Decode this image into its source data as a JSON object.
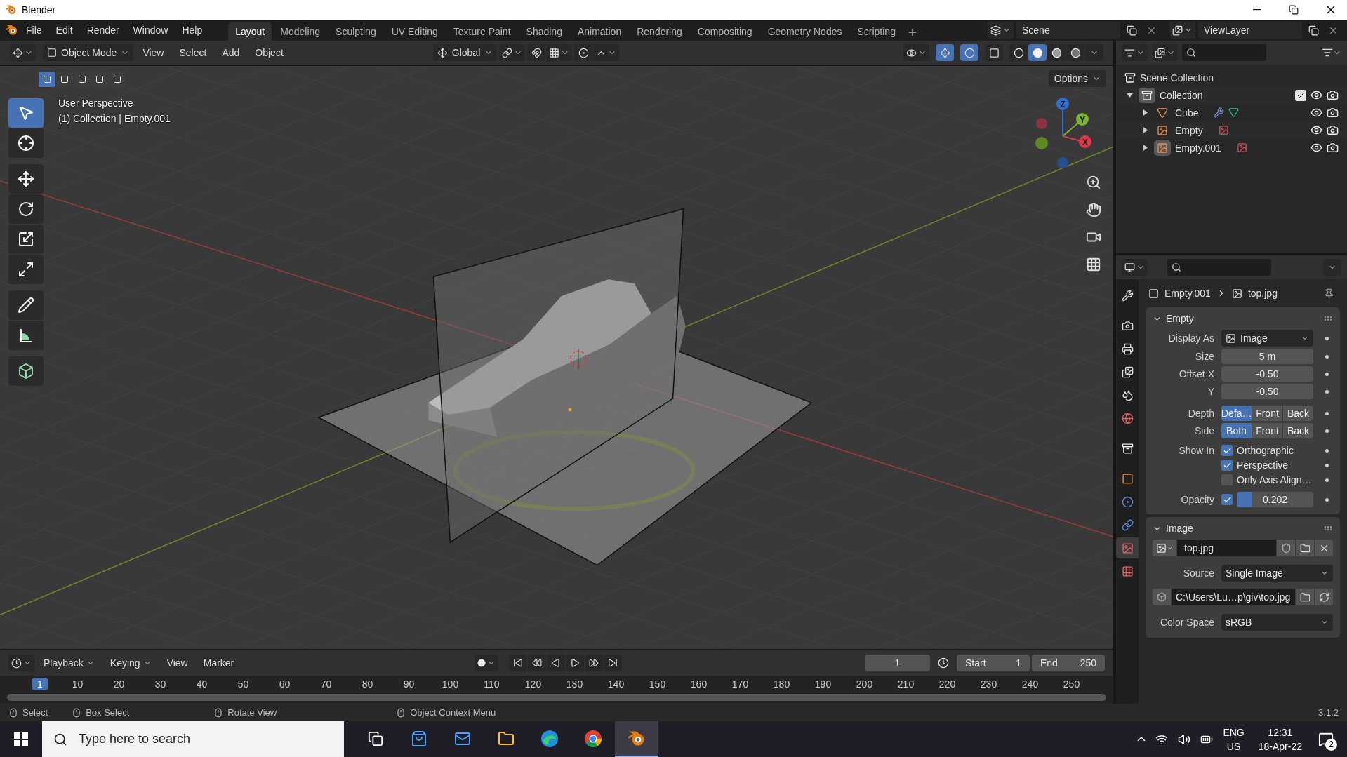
{
  "title_bar": {
    "title": "Blender"
  },
  "menu": [
    "File",
    "Edit",
    "Render",
    "Window",
    "Help"
  ],
  "workspaces": [
    {
      "label": "Layout",
      "selected": true
    },
    {
      "label": "Modeling",
      "selected": false
    },
    {
      "label": "Sculpting",
      "selected": false
    },
    {
      "label": "UV Editing",
      "selected": false
    },
    {
      "label": "Texture Paint",
      "selected": false
    },
    {
      "label": "Shading",
      "selected": false
    },
    {
      "label": "Animation",
      "selected": false
    },
    {
      "label": "Rendering",
      "selected": false
    },
    {
      "label": "Compositing",
      "selected": false
    },
    {
      "label": "Geometry Nodes",
      "selected": false
    },
    {
      "label": "Scripting",
      "selected": false
    }
  ],
  "scene": "Scene",
  "view_layer": "ViewLayer",
  "viewport": {
    "mode": "Object Mode",
    "menus": [
      "View",
      "Select",
      "Add",
      "Object"
    ],
    "orientation": "Global",
    "options": "Options",
    "select_modes": [
      {
        "selected": true
      },
      {
        "selected": false
      },
      {
        "selected": false
      },
      {
        "selected": false
      },
      {
        "selected": false
      }
    ],
    "toggles": [
      {
        "kind": "gizmo",
        "on": true
      },
      {
        "kind": "overlay",
        "on": true
      },
      {
        "kind": "xray",
        "on": false
      }
    ],
    "shading_modes": [
      {
        "kind": "wireframe",
        "selected": false
      },
      {
        "kind": "solid",
        "selected": true
      },
      {
        "kind": "material",
        "selected": false
      },
      {
        "kind": "rendered",
        "selected": false
      }
    ],
    "overlay_lines": [
      "User Perspective",
      "(1) Collection | Empty.001"
    ],
    "tools": [
      {
        "kind": "select",
        "selected": true
      },
      {
        "kind": "cursor",
        "selected": false
      },
      {
        "kind": "move",
        "selected": false
      },
      {
        "kind": "rotate",
        "selected": false
      },
      {
        "kind": "scale",
        "selected": false
      },
      {
        "kind": "transform",
        "selected": false
      },
      {
        "kind": "annotate",
        "selected": false
      },
      {
        "kind": "measure",
        "selected": false
      },
      {
        "kind": "add_cube",
        "selected": false
      }
    ],
    "gizmo_axes": [
      "Z",
      "Y",
      "X"
    ]
  },
  "outliner": {
    "root": "Scene Collection",
    "items": [
      {
        "name": "Collection",
        "kind": "collection",
        "selected": true,
        "expanded": true,
        "checked": true,
        "children": [
          {
            "name": "Cube",
            "kind": "mesh",
            "selected": false,
            "expanded": false
          },
          {
            "name": "Empty",
            "kind": "empty",
            "selected": false,
            "expanded": false
          },
          {
            "name": "Empty.001",
            "kind": "empty",
            "selected": true,
            "expanded": false
          }
        ]
      }
    ]
  },
  "properties": {
    "tabs": [
      {
        "kind": "tool",
        "selected": false
      },
      {
        "kind": "render",
        "selected": false
      },
      {
        "kind": "output",
        "selected": false
      },
      {
        "kind": "view_layer",
        "selected": false
      },
      {
        "kind": "scene",
        "selected": false
      },
      {
        "kind": "world",
        "selected": false
      },
      {
        "kind": "collection",
        "selected": false
      },
      {
        "kind": "object",
        "selected": false
      },
      {
        "kind": "physics",
        "selected": false
      },
      {
        "kind": "constraints",
        "selected": false
      },
      {
        "kind": "data",
        "selected": true
      },
      {
        "kind": "texture",
        "selected": false
      }
    ],
    "breadcrumb": [
      "Empty.001",
      "top.jpg"
    ],
    "empty_panel": {
      "title": "Empty",
      "expanded": true,
      "display_as": {
        "label": "Display As",
        "value": "Image"
      },
      "size": {
        "label": "Size",
        "value": "5 m"
      },
      "offset_x": {
        "label": "Offset X",
        "value": "-0.50"
      },
      "offset_y": {
        "label": "Y",
        "value": "-0.50"
      },
      "depth": {
        "label": "Depth",
        "options": [
          {
            "label": "Defa…",
            "selected": true
          },
          {
            "label": "Front",
            "selected": false
          },
          {
            "label": "Back",
            "selected": false
          }
        ]
      },
      "side": {
        "label": "Side",
        "options": [
          {
            "label": "Both",
            "selected": true
          },
          {
            "label": "Front",
            "selected": false
          },
          {
            "label": "Back",
            "selected": false
          }
        ]
      },
      "show_in": {
        "label": "Show In",
        "options": [
          {
            "label": "Orthographic",
            "checked": true
          },
          {
            "label": "Perspective",
            "checked": true
          },
          {
            "label": "Only Axis Align…",
            "checked": false
          }
        ]
      },
      "opacity": {
        "label": "Opacity",
        "checked": true,
        "level": 0.202,
        "reading": "0.202"
      }
    },
    "image_panel": {
      "title": "Image",
      "expanded": true,
      "image": "top.jpg",
      "source": {
        "label": "Source",
        "value": "Single Image"
      },
      "filepath": "C:\\Users\\Lu…p\\giv\\top.jpg",
      "color_space": {
        "label": "Color Space",
        "value": "sRGB"
      }
    }
  },
  "timeline": {
    "menus": [
      "Playback",
      "Keying",
      "View",
      "Marker"
    ],
    "current_frame": "1",
    "start": {
      "label": "Start",
      "value": "1"
    },
    "end": {
      "label": "End",
      "value": "250"
    },
    "ticks": [
      {
        "label": "1",
        "selected": true
      },
      {
        "label": "10",
        "selected": false
      },
      {
        "label": "20",
        "selected": false
      },
      {
        "label": "30",
        "selected": false
      },
      {
        "label": "40",
        "selected": false
      },
      {
        "label": "50",
        "selected": false
      },
      {
        "label": "60",
        "selected": false
      },
      {
        "label": "70",
        "selected": false
      },
      {
        "label": "80",
        "selected": false
      },
      {
        "label": "90",
        "selected": false
      },
      {
        "label": "100",
        "selected": false
      },
      {
        "label": "110",
        "selected": false
      },
      {
        "label": "120",
        "selected": false
      },
      {
        "label": "130",
        "selected": false
      },
      {
        "label": "140",
        "selected": false
      },
      {
        "label": "150",
        "selected": false
      },
      {
        "label": "160",
        "selected": false
      },
      {
        "label": "170",
        "selected": false
      },
      {
        "label": "180",
        "selected": false
      },
      {
        "label": "190",
        "selected": false
      },
      {
        "label": "200",
        "selected": false
      },
      {
        "label": "210",
        "selected": false
      },
      {
        "label": "220",
        "selected": false
      },
      {
        "label": "230",
        "selected": false
      },
      {
        "label": "240",
        "selected": false
      },
      {
        "label": "250",
        "selected": false
      }
    ]
  },
  "status_bar": {
    "hints": [
      "Select",
      "Box Select",
      "Rotate View",
      "Object Context Menu"
    ],
    "version": "3.1.2"
  },
  "taskbar": {
    "search_placeholder": "Type here to search",
    "apps": [
      {
        "kind": "task_view",
        "selected": false
      },
      {
        "kind": "store",
        "selected": false
      },
      {
        "kind": "mail",
        "selected": false
      },
      {
        "kind": "explorer",
        "selected": false
      },
      {
        "kind": "edge",
        "selected": false
      },
      {
        "kind": "chrome",
        "selected": false
      },
      {
        "kind": "blender",
        "selected": true
      }
    ],
    "language": "ENG",
    "region": "US",
    "time": "12:31",
    "date": "18-Apr-22",
    "notifications": "2"
  }
}
